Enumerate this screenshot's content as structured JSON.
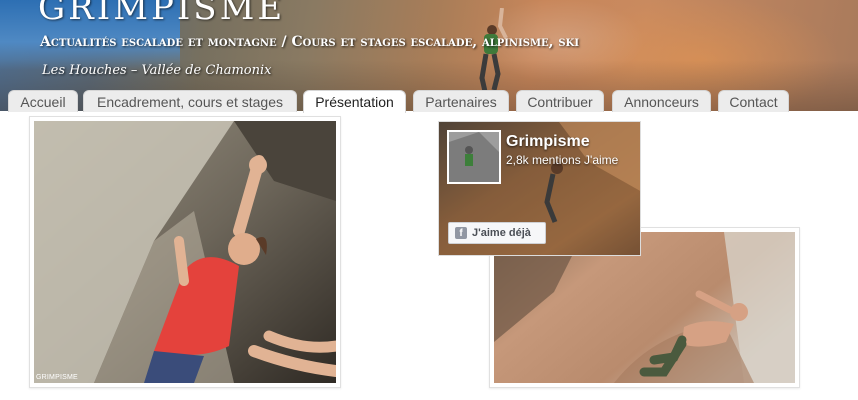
{
  "header": {
    "site_name": "GRIMPISME",
    "tagline": "Actualités escalade et montagne / Cours et stages escalade, alpinisme, ski",
    "location": "Les Houches – Vallée de Chamonix"
  },
  "nav": {
    "tabs": [
      {
        "label": "Accueil",
        "active": false
      },
      {
        "label": "Encadrement, cours et stages",
        "active": false
      },
      {
        "label": "Présentation",
        "active": true
      },
      {
        "label": "Partenaires",
        "active": false
      },
      {
        "label": "Contribuer",
        "active": false
      },
      {
        "label": "Annonceurs",
        "active": false
      },
      {
        "label": "Contact",
        "active": false
      }
    ]
  },
  "photos": {
    "left_caption": "GRIMPISME"
  },
  "facebook": {
    "page_name": "Grimpisme",
    "likes": "2,8k mentions J'aime",
    "like_button": "J'aime déjà",
    "fb_icon": "f"
  },
  "colors": {
    "tab_bg": "#ececec",
    "tab_active_bg": "#ffffff",
    "fb_button_bg": "#f6f7f9",
    "fb_icon": "#9197a3"
  }
}
